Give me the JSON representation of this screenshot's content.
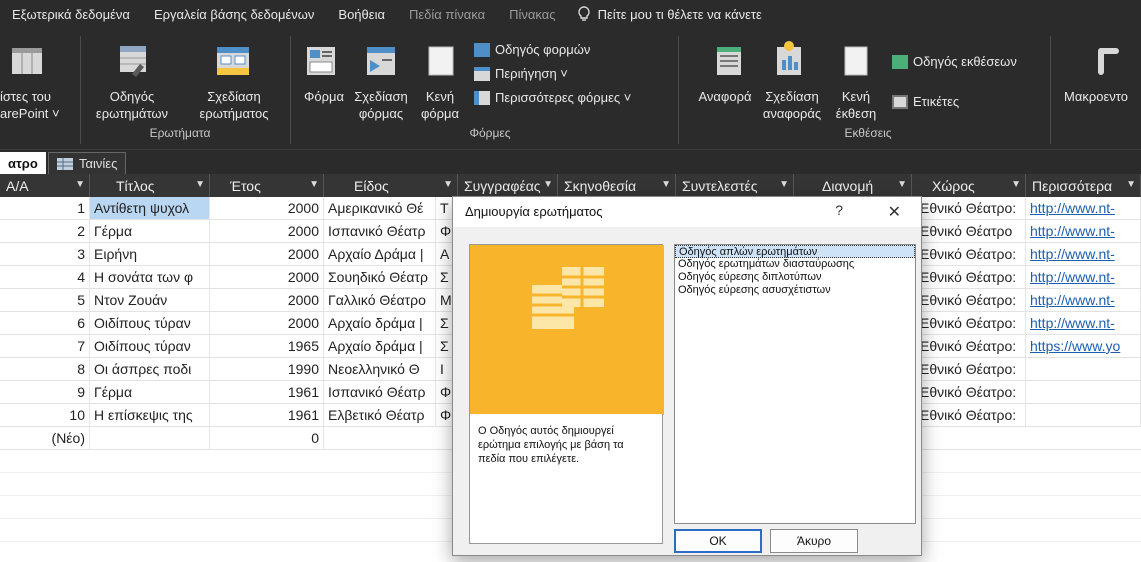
{
  "menubar": {
    "items": [
      "Εξωτερικά δεδομένα",
      "Εργαλεία βάσης δεδομένων",
      "Βοήθεια"
    ],
    "dim_items": [
      "Πεδία πίνακα",
      "Πίνακας"
    ],
    "tell_me": "Πείτε μου τι θέλετε να κάνετε"
  },
  "ribbon": {
    "sharepoint": {
      "line1": "ίστες του",
      "line2": "arePoint ˅"
    },
    "queries": {
      "wizard": {
        "line1": "Οδηγός",
        "line2": "ερωτημάτων"
      },
      "design": {
        "line1": "Σχεδίαση",
        "line2": "ερωτήματος"
      },
      "label": "Ερωτήματα"
    },
    "forms": {
      "form": "Φόρμα",
      "design": {
        "line1": "Σχεδίαση",
        "line2": "φόρμας"
      },
      "blank": {
        "line1": "Κενή",
        "line2": "φόρμα"
      },
      "form_wizard": "Οδηγός φορμών",
      "navigation": "Περιήγηση ˅",
      "more": "Περισσότερες φόρμες ˅",
      "label": "Φόρμες"
    },
    "reports": {
      "report": "Αναφορά",
      "design": {
        "line1": "Σχεδίαση",
        "line2": "αναφοράς"
      },
      "blank": {
        "line1": "Κενή",
        "line2": "έκθεση"
      },
      "report_wizard": "Οδηγός εκθέσεων",
      "labels": "Ετικέτες",
      "label": "Εκθέσεις"
    },
    "macro": "Μακροεντο"
  },
  "tabs": {
    "active": "ατρο",
    "other": "Ταινίες"
  },
  "table": {
    "columns": [
      "Α/Α",
      "Τίτλος",
      "Έτος",
      "Είδος",
      "Συγγραφέας",
      "Σκηνοθεσία",
      "Συντελεστές",
      "Διανομή",
      "Χώρος",
      "Περισσότερα"
    ],
    "rows": [
      {
        "id": "1",
        "title": "Αντίθετη ψυχολ",
        "year": "2000",
        "genre": "Αμερικανικό Θέ",
        "author": "Τ",
        "venue": "Εθνικό Θέατρο:",
        "more": "http://www.nt-"
      },
      {
        "id": "2",
        "title": "Γέρμα",
        "year": "2000",
        "genre": "Ισπανικό Θέατρ",
        "author": "Φ",
        "venue": "Εθνικό Θέατρο",
        "more": "http://www.nt-"
      },
      {
        "id": "3",
        "title": "Ειρήνη",
        "year": "2000",
        "genre": "Αρχαίο Δράμα |",
        "author": "Α",
        "venue": "Εθνικό Θέατρο:",
        "more": "http://www.nt-"
      },
      {
        "id": "4",
        "title": "Η σονάτα των φ",
        "year": "2000",
        "genre": "Σουηδικό Θέατρ",
        "author": "Σ",
        "venue": "Εθνικό Θέατρο:",
        "more": "http://www.nt-"
      },
      {
        "id": "5",
        "title": "Ντον Ζουάν",
        "year": "2000",
        "genre": "Γαλλικό Θέατρο",
        "author": "Μ",
        "venue": "Εθνικό Θέατρο:",
        "more": "http://www.nt-"
      },
      {
        "id": "6",
        "title": "Οιδίπους τύραν",
        "year": "2000",
        "genre": "Αρχαίο δράμα |",
        "author": "Σ",
        "venue": "Εθνικό Θέατρο:",
        "more": "http://www.nt-"
      },
      {
        "id": "7",
        "title": "Οιδίπους τύραν",
        "year": "1965",
        "genre": "Αρχαίο δράμα |",
        "author": "Σ",
        "venue": "Εθνικό Θέατρο:",
        "more": "https://www.yo"
      },
      {
        "id": "8",
        "title": "Οι άσπρες ποδι",
        "year": "1990",
        "genre": "Νεοελληνικό Θ",
        "author": "Ι",
        "venue": "Εθνικό Θέατρο:",
        "more": ""
      },
      {
        "id": "9",
        "title": "Γέρμα",
        "year": "1961",
        "genre": "Ισπανικό Θέατρ",
        "author": "Φ",
        "venue": "Εθνικό Θέατρο:",
        "more": ""
      },
      {
        "id": "10",
        "title": "Η επίσκεψις της",
        "year": "1961",
        "genre": "Ελβετικό Θέατρ",
        "author": "Φ",
        "venue": "Εθνικό Θέατρο:",
        "more": ""
      }
    ],
    "new_row": {
      "id": "(Νέο)",
      "year": "0"
    }
  },
  "dialog": {
    "title": "Δημιουργία ερωτήματος",
    "help": "?",
    "close": "✕",
    "description": "Ο Οδηγός αυτός δημιουργεί ερώτημα επιλογής με βάση τα πεδία που επιλέγετε.",
    "options": [
      "Οδηγός απλών ερωτημάτων",
      "Οδηγός ερωτημάτων διασταύρωσης",
      "Οδηγός εύρεσης διπλοτύπων",
      "Οδηγός εύρεσης ασυσχέτιστων"
    ],
    "ok": "OK",
    "cancel": "Άκυρο"
  }
}
